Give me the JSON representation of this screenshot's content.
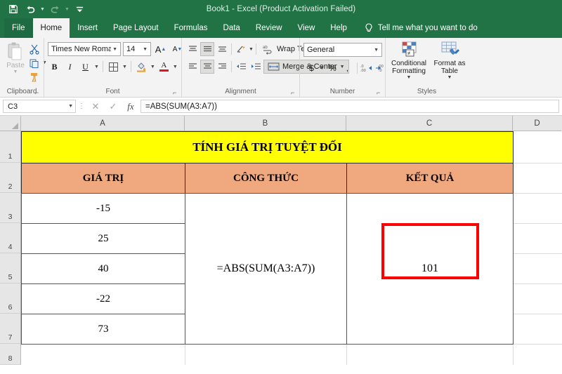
{
  "window": {
    "title": "Book1  -  Excel (Product Activation Failed)"
  },
  "quick_access": {
    "save_icon": "save-icon",
    "undo_icon": "undo-icon",
    "redo_icon": "redo-icon",
    "customize_icon": "customize-qat-icon"
  },
  "ribbon_tabs": [
    {
      "label": "File",
      "active": false
    },
    {
      "label": "Home",
      "active": true
    },
    {
      "label": "Insert",
      "active": false
    },
    {
      "label": "Page Layout",
      "active": false
    },
    {
      "label": "Formulas",
      "active": false
    },
    {
      "label": "Data",
      "active": false
    },
    {
      "label": "Review",
      "active": false
    },
    {
      "label": "View",
      "active": false
    },
    {
      "label": "Help",
      "active": false
    }
  ],
  "tell_me": {
    "label": "Tell me what you want to do",
    "icon": "lightbulb-icon"
  },
  "ribbon": {
    "clipboard": {
      "label": "Clipboard",
      "paste_label": "Paste",
      "cut_icon": "scissors-icon",
      "copy_icon": "copy-icon",
      "format_painter_icon": "format-painter-icon"
    },
    "font": {
      "label": "Font",
      "font_name": "Times New Roman",
      "font_size": "14",
      "grow_label": "A",
      "shrink_label": "A",
      "bold_label": "B",
      "italic_label": "I",
      "underline_label": "U",
      "borders_icon": "borders-icon",
      "fill_color_icon": "fill-color-icon",
      "font_color_label": "A"
    },
    "alignment": {
      "label": "Alignment",
      "wrap_text_label": "Wrap Text",
      "merge_center_label": "Merge & Center"
    },
    "number": {
      "label": "Number",
      "format_value": "General",
      "currency_label": "$",
      "percent_label": "%",
      "comma_label": ",",
      "decrease_decimal_icon": "decrease-decimal-icon",
      "increase_decimal_icon": "increase-decimal-icon"
    },
    "styles": {
      "label": "Styles",
      "conditional_formatting_label": "Conditional Formatting",
      "format_as_table_label": "Format as Table"
    }
  },
  "formula_bar": {
    "name_box": "C3",
    "cancel_icon": "cancel-icon",
    "enter_icon": "confirm-icon",
    "function_icon": "insert-function-icon",
    "formula": "=ABS(SUM(A3:A7))"
  },
  "grid": {
    "columns": [
      "A",
      "B",
      "C",
      "D"
    ],
    "rows": [
      "1",
      "2",
      "3",
      "4",
      "5",
      "6",
      "7",
      "8"
    ],
    "title_cell": "TÍNH GIÁ TRỊ TUYỆT ĐỐI",
    "headers": [
      "GIÁ TRỊ",
      "CÔNG THỨC",
      "KẾT QUẢ"
    ],
    "values": [
      "-15",
      "25",
      "40",
      "-22",
      "73"
    ],
    "formula_cell": "=ABS(SUM(A3:A7))",
    "result_cell": "101"
  },
  "colors": {
    "excel_green": "#217346",
    "title_fill": "#ffff00",
    "header_fill": "#f0a97f",
    "highlight_box": "#ff0000"
  }
}
